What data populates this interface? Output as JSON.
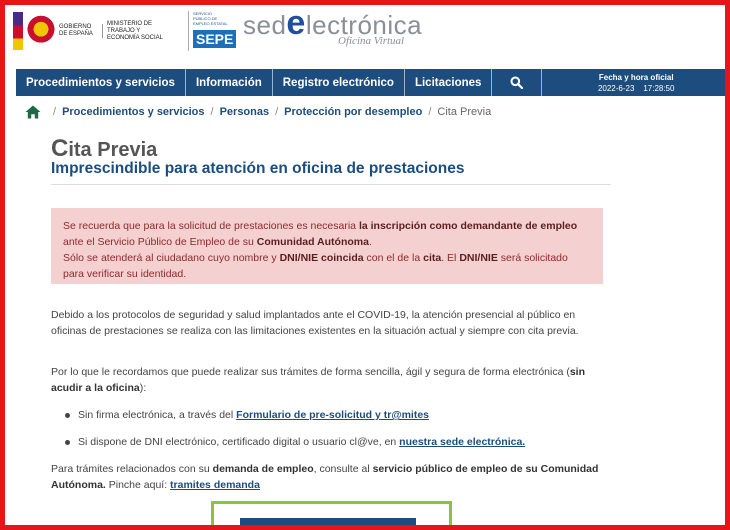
{
  "header": {
    "gov_text": "Gobierno de España",
    "ministry_text": "Ministerio de Trabajo y Economía Social",
    "sepe_small": "Servicio Público de Empleo Estatal",
    "sepe_big": "SEPE",
    "sede_prefix": "sed",
    "sede_e": "e",
    "sede_suffix": "lectrónica",
    "sede_sub": "Oficina Virtual"
  },
  "nav": {
    "items": [
      "Procedimientos y servicios",
      "Información",
      "Registro electrónico",
      "Licitaciones"
    ],
    "search_icon": "search-icon",
    "clock_label": "Fecha y hora oficial",
    "clock_value": "2022-6-23    17:28:50"
  },
  "breadcrumb": {
    "items": [
      "Procedimientos y servicios",
      "Personas",
      "Protección por desempleo"
    ],
    "current": "Cita Previa",
    "separator": "/"
  },
  "page": {
    "title_first": "C",
    "title_rest": "ita Previa",
    "subtitle": "Imprescindible para atención en oficina de prestaciones"
  },
  "alert": {
    "p1_a": "Se recuerda que para la solicitud de prestaciones es necesaria ",
    "p1_b": "la inscripción como demandante de empleo",
    "p1_c": " ante el Servicio Público de Empleo de su ",
    "p1_d": "Comunidad Autónoma",
    "p1_e": ".",
    "p2_a": "Sólo se atenderá al ciudadano cuyo nombre y ",
    "p2_b": "DNI/NIE coincida",
    "p2_c": " con el de la ",
    "p2_d": "cita",
    "p2_e": ". El ",
    "p2_f": "DNI/NIE",
    "p2_g": " será solicitado para verificar su identidad."
  },
  "content": {
    "para1": "Debido a los protocolos de seguridad y salud implantados ante el COVID-19, la atención presencial al público en oficinas de prestaciones se realiza con las limitaciones existentes en la situación actual y siempre con cita previa.",
    "para2_a": "Por lo que le recordamos que puede realizar sus trámites de forma sencilla, ágil y segura de forma electrónica (",
    "para2_b": "sin acudir a la oficina",
    "para2_c": "):",
    "bullet1_a": "Sin firma electrónica, a través del ",
    "bullet1_link": "Formulario de pre-solicitud y tr@mites",
    "bullet2_a": "Si dispone de DNI electrónico, certificado digital o usuario cl@ve, en ",
    "bullet2_link": "nuestra sede electrónica.",
    "para3_a": "Para trámites relacionados con su ",
    "para3_b": "demanda de empleo",
    "para3_c": ", consulte al ",
    "para3_d": "servicio público de empleo de su Comunidad Autónoma.",
    "para3_e": " Pinche aquí: ",
    "para3_link": "tramites demanda"
  }
}
